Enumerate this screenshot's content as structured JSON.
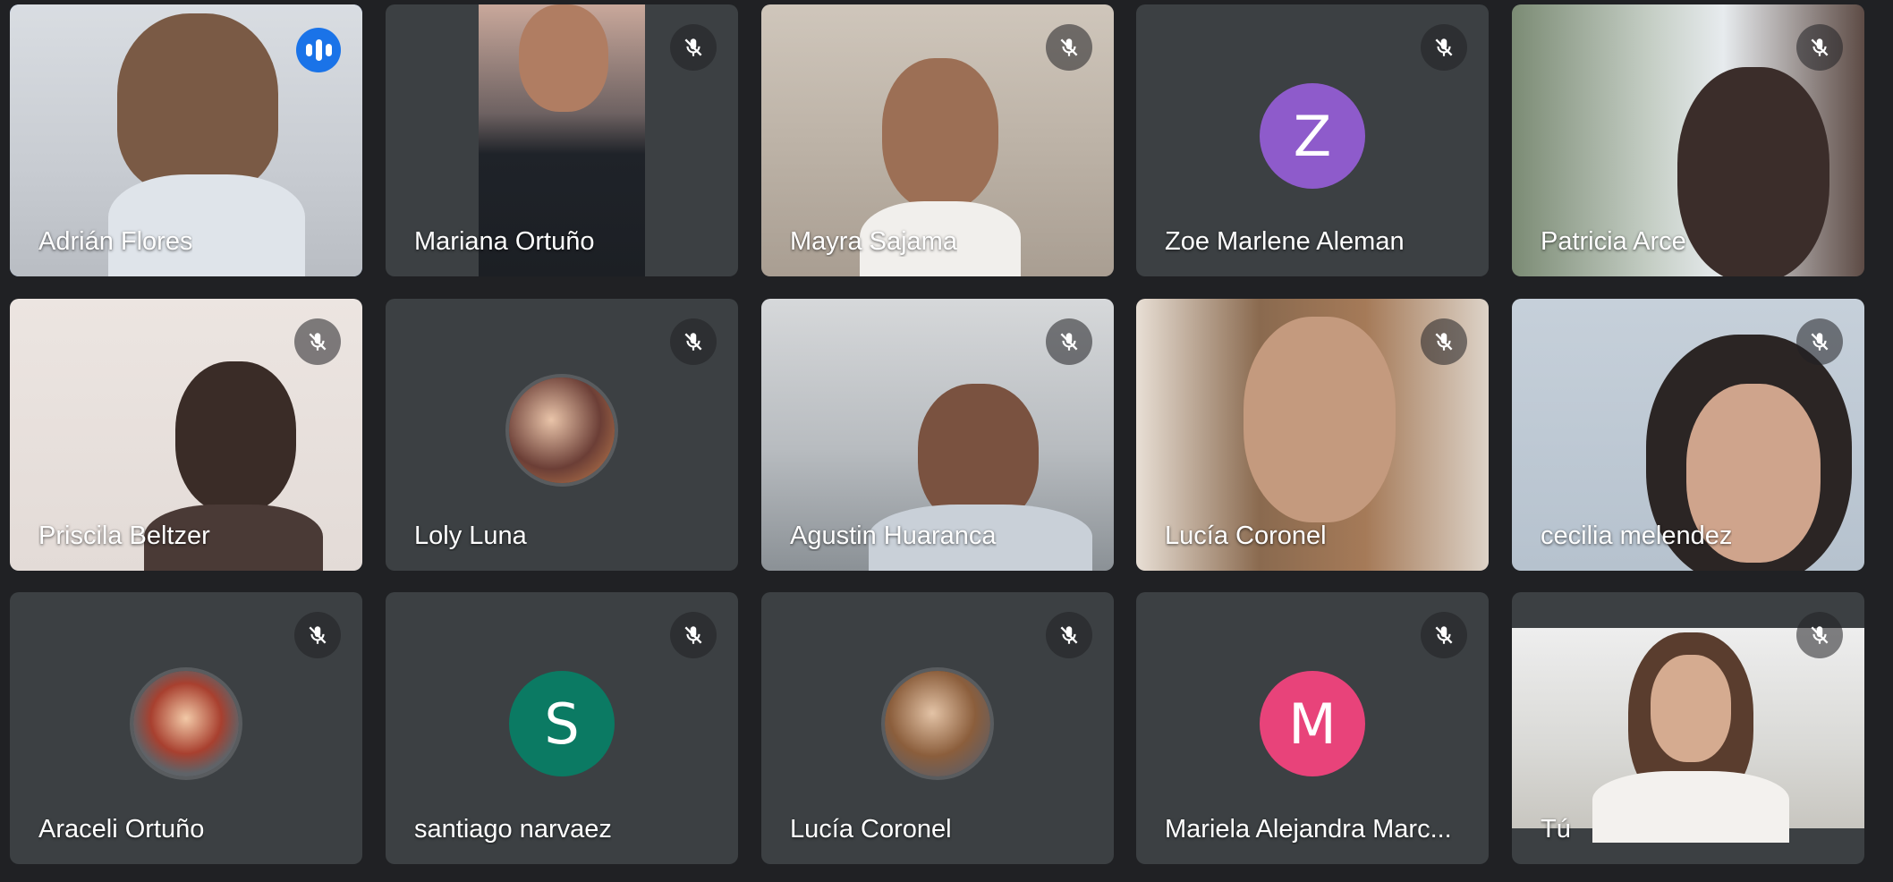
{
  "colors": {
    "background": "#202124",
    "tile": "#3c4043",
    "active_border": "#669df6",
    "speaking_badge": "#1a73e8"
  },
  "participants": [
    {
      "name": "Adrián Flores",
      "status": "speaking",
      "display": "video",
      "active": true
    },
    {
      "name": "Mariana Ortuño",
      "status": "muted",
      "display": "video"
    },
    {
      "name": "Mayra Sajama",
      "status": "muted",
      "display": "video"
    },
    {
      "name": "Zoe Marlene Aleman",
      "status": "muted",
      "display": "letter-avatar",
      "initial": "Z",
      "avatar_color": "#8e5bcb"
    },
    {
      "name": "Patricia Arce",
      "status": "muted",
      "display": "video"
    },
    {
      "name": "Priscila Beltzer",
      "status": "muted",
      "display": "video"
    },
    {
      "name": "Loly Luna",
      "status": "muted",
      "display": "photo-avatar"
    },
    {
      "name": "Agustin Huaranca",
      "status": "muted",
      "display": "video"
    },
    {
      "name": "Lucía Coronel",
      "status": "muted",
      "display": "video"
    },
    {
      "name": "cecilia melendez",
      "status": "muted",
      "display": "video"
    },
    {
      "name": "Araceli Ortuño",
      "status": "muted",
      "display": "photo-avatar"
    },
    {
      "name": "santiago narvaez",
      "status": "muted",
      "display": "letter-avatar",
      "initial": "S",
      "avatar_color": "#0b7a63"
    },
    {
      "name": "Lucía Coronel",
      "status": "muted",
      "display": "photo-avatar"
    },
    {
      "name": "Mariela Alejandra Marc...",
      "status": "muted",
      "display": "letter-avatar",
      "initial": "M",
      "avatar_color": "#e8437a"
    },
    {
      "name": "Tú",
      "status": "muted",
      "display": "video"
    }
  ]
}
